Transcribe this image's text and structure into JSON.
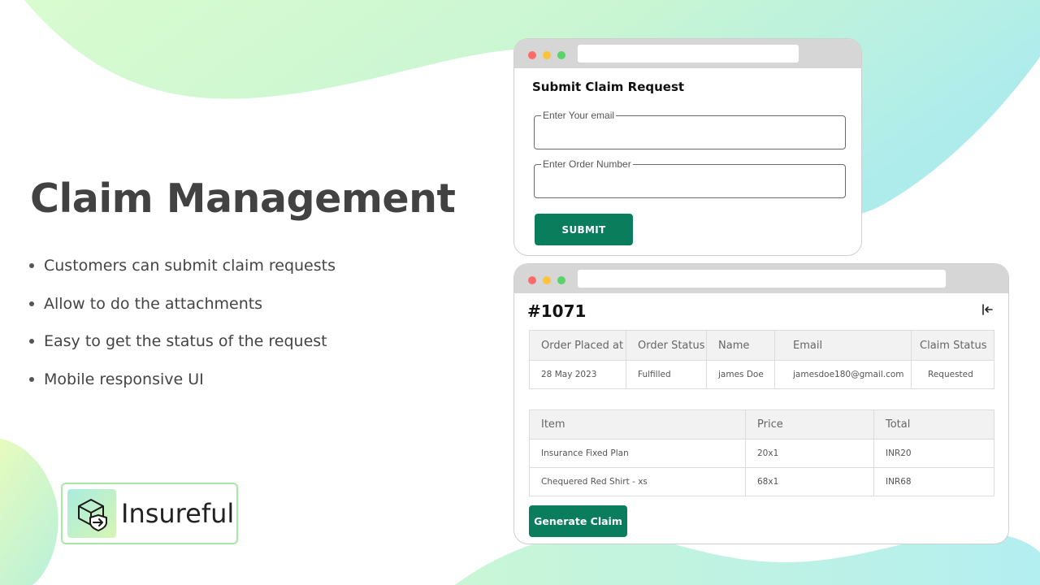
{
  "hero": {
    "title": "Claim Management",
    "features": [
      "Customers can submit claim requests",
      "Allow to do the attachments",
      "Easy to get the status of the request",
      "Mobile responsive UI"
    ]
  },
  "brand": {
    "name": "Insureful"
  },
  "colors": {
    "accent": "#0a7d5c",
    "blob_green": "#c8f7cf",
    "blob_teal": "#b2eef0"
  },
  "claim_form": {
    "title": "Submit Claim Request",
    "email_label": "Enter Your email",
    "email_value": "",
    "order_label": "Enter Order Number",
    "order_value": "",
    "submit_label": "SUBMIT"
  },
  "claim_detail": {
    "order_id": "#1071",
    "order_table": {
      "headers": [
        "Order Placed at",
        "Order Status",
        "Name",
        "Email",
        "Claim Status"
      ],
      "row": [
        "28 May 2023",
        "Fulfilled",
        "james Doe",
        "jamesdoe180@gmail.com",
        "Requested"
      ]
    },
    "items_table": {
      "headers": [
        "Item",
        "Price",
        "Total"
      ],
      "rows": [
        [
          "Insurance Fixed Plan",
          "20x1",
          "INR20"
        ],
        [
          "Chequered Red Shirt - xs",
          "68x1",
          "INR68"
        ]
      ]
    },
    "generate_label": "Generate Claim"
  }
}
